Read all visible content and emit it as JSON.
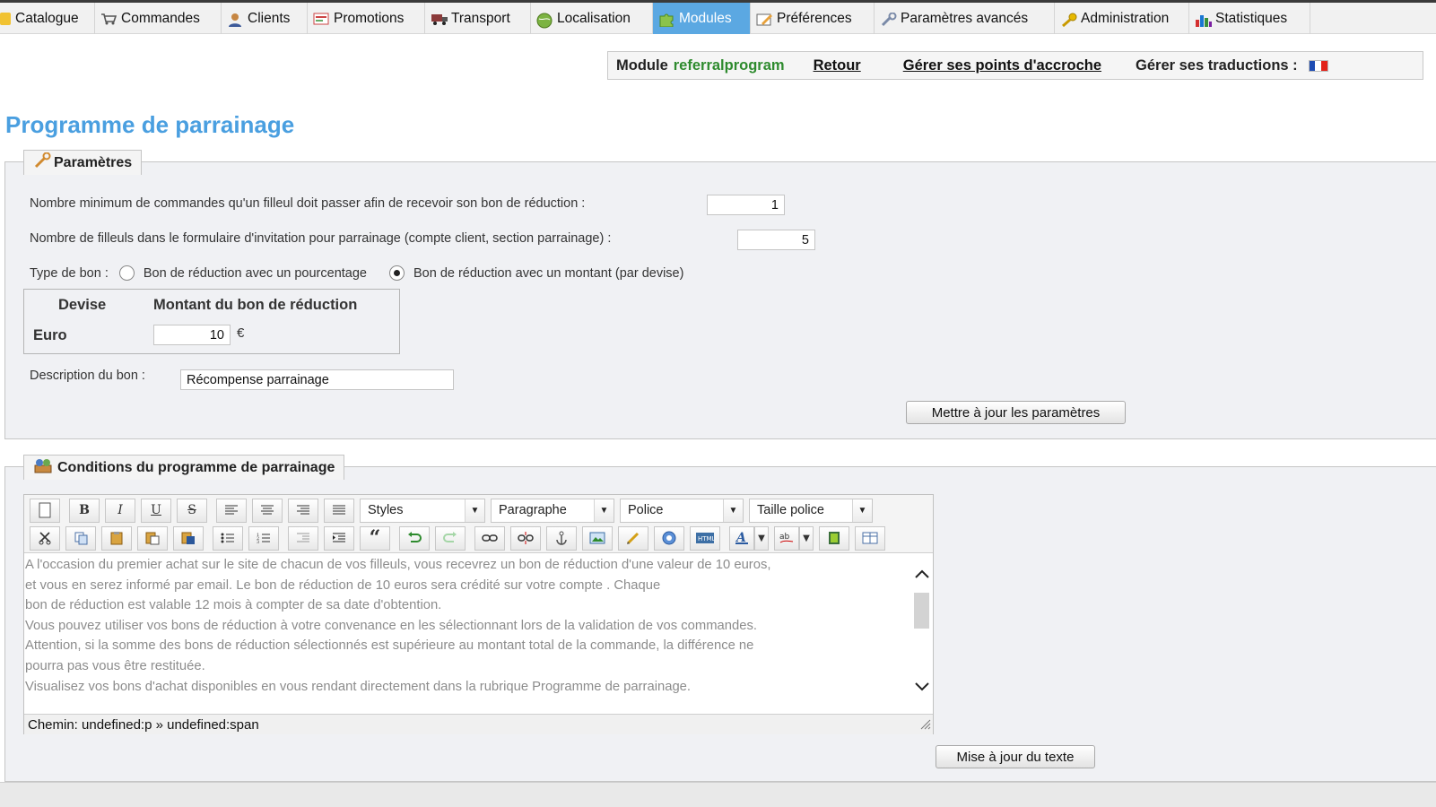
{
  "nav": {
    "tabs": [
      {
        "label": "Catalogue",
        "icon": "folder-icon"
      },
      {
        "label": "Commandes",
        "icon": "cart-icon"
      },
      {
        "label": "Clients",
        "icon": "user-icon"
      },
      {
        "label": "Promotions",
        "icon": "promotion-icon"
      },
      {
        "label": "Transport",
        "icon": "truck-icon"
      },
      {
        "label": "Localisation",
        "icon": "globe-icon"
      },
      {
        "label": "Modules",
        "icon": "puzzle-icon"
      },
      {
        "label": "Préférences",
        "icon": "preferences-icon"
      },
      {
        "label": "Paramètres avancés",
        "icon": "wrench-icon"
      },
      {
        "label": "Administration",
        "icon": "key-icon"
      },
      {
        "label": "Statistiques",
        "icon": "bar-chart-icon"
      }
    ],
    "active_tab": "Modules"
  },
  "module_bar": {
    "module_label": "Module",
    "module_name": "referralprogram",
    "back_link": "Retour",
    "hooks_link": "Gérer ses points d'accroche",
    "translations_label": "Gérer ses traductions :",
    "flag_icon": "french-flag-icon"
  },
  "page_title": "Programme de parrainage",
  "params": {
    "legend": "Paramètres",
    "min_orders_label": "Nombre minimum de commandes qu'un filleul doit passer afin de recevoir son bon de réduction :",
    "min_orders_value": "1",
    "nb_friends_label": "Nombre de filleuls dans le formulaire d'invitation pour parrainage (compte client, section parrainage) :",
    "nb_friends_value": "5",
    "voucher_type_label": "Type de bon :",
    "voucher_type_percent": "Bon de réduction avec un pourcentage",
    "voucher_type_amount": "Bon de réduction avec un montant (par devise)",
    "voucher_type_selected": "amount",
    "currency_header": "Devise",
    "amount_header": "Montant du bon de réduction",
    "currency_name": "Euro",
    "currency_amount": "10",
    "currency_symbol": "€",
    "description_label": "Description du bon :",
    "description_value": "Récompense parrainage",
    "update_button": "Mettre à jour les paramètres"
  },
  "conditions": {
    "legend": "Conditions du programme de parrainage",
    "toolbar": {
      "styles": "Styles",
      "paragraph": "Paragraphe",
      "font": "Police",
      "font_size": "Taille police",
      "bold": "B",
      "italic": "I",
      "underline": "U",
      "strike": "S",
      "quote": "“"
    },
    "text_lines": [
      "A l'occasion du premier achat sur le site de chacun de vos filleuls, vous recevrez un bon de réduction d'une valeur de 10 euros,",
      "et vous en serez informé par email. Le bon de réduction de 10 euros sera crédité sur votre compte                         . Chaque",
      "bon de réduction est valable 12 mois à compter de sa date d'obtention.",
      "Vous pouvez utiliser vos bons de réduction à votre convenance en les sélectionnant lors de la validation de vos commandes.",
      "Attention, si la somme des bons de réduction sélectionnés est supérieure au montant total de la commande, la différence ne",
      "pourra pas vous être restituée.",
      "Visualisez vos bons d'achat disponibles en vous rendant directement dans la rubrique Programme de parrainage."
    ],
    "status_path": "Chemin: undefined:p » undefined:span",
    "update_text_button": "Mise à jour du texte"
  }
}
